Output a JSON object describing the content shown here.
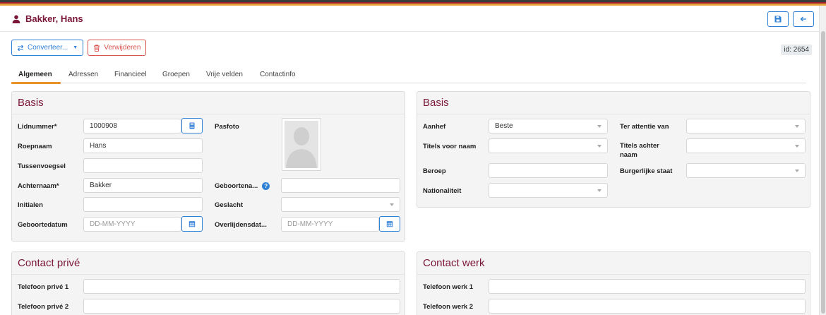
{
  "header": {
    "title": "Bakker, Hans",
    "person_icon": "user-icon",
    "save_icon": "save-icon",
    "back_icon": "arrow-left-icon"
  },
  "toolbar": {
    "convert_label": "Converteer...",
    "delete_label": "Verwijderen",
    "id_label": "id: 2654"
  },
  "tabs": [
    {
      "label": "Algemeen",
      "active": true
    },
    {
      "label": "Adressen"
    },
    {
      "label": "Financieel"
    },
    {
      "label": "Groepen"
    },
    {
      "label": "Vrije velden"
    },
    {
      "label": "Contactinfo"
    }
  ],
  "basis_left": {
    "title": "Basis",
    "fields": {
      "lidnummer": {
        "label": "Lidnummer*",
        "value": "1000908"
      },
      "roepnaam": {
        "label": "Roepnaam",
        "value": "Hans"
      },
      "tussenvoegsel": {
        "label": "Tussenvoegsel",
        "value": ""
      },
      "achternaam": {
        "label": "Achternaam*",
        "value": "Bakker"
      },
      "initialen": {
        "label": "Initialen",
        "value": ""
      },
      "geboortedatum": {
        "label": "Geboortedatum",
        "placeholder": "DD-MM-YYYY"
      },
      "pasfoto": {
        "label": "Pasfoto"
      },
      "geboortenaam": {
        "label": "Geboortena...",
        "value": ""
      },
      "geslacht": {
        "label": "Geslacht",
        "value": ""
      },
      "overlijdensdatum": {
        "label": "Overlijdensdat...",
        "placeholder": "DD-MM-YYYY"
      }
    }
  },
  "basis_right": {
    "title": "Basis",
    "fields": {
      "aanhef": {
        "label": "Aanhef",
        "value": "Beste"
      },
      "titels_voor": {
        "label": "Titels voor naam",
        "value": ""
      },
      "beroep": {
        "label": "Beroep",
        "value": ""
      },
      "nationaliteit": {
        "label": "Nationaliteit",
        "value": ""
      },
      "ter_attentie": {
        "label": "Ter attentie van",
        "value": ""
      },
      "titels_achter": {
        "label": "Titels achter naam",
        "value": ""
      },
      "burgerlijke_staat": {
        "label": "Burgerlijke staat",
        "value": ""
      }
    }
  },
  "contact_prive": {
    "title": "Contact privé",
    "telefoon1_label": "Telefoon privé 1",
    "telefoon2_label": "Telefoon privé 2"
  },
  "contact_werk": {
    "title": "Contact werk",
    "telefoon1_label": "Telefoon werk 1",
    "telefoon2_label": "Telefoon werk 2"
  },
  "colors": {
    "accent_blue": "#2e7fd6",
    "brand_maroon": "#7a1638",
    "tab_underline": "#e8922c",
    "danger": "#d9534f"
  }
}
